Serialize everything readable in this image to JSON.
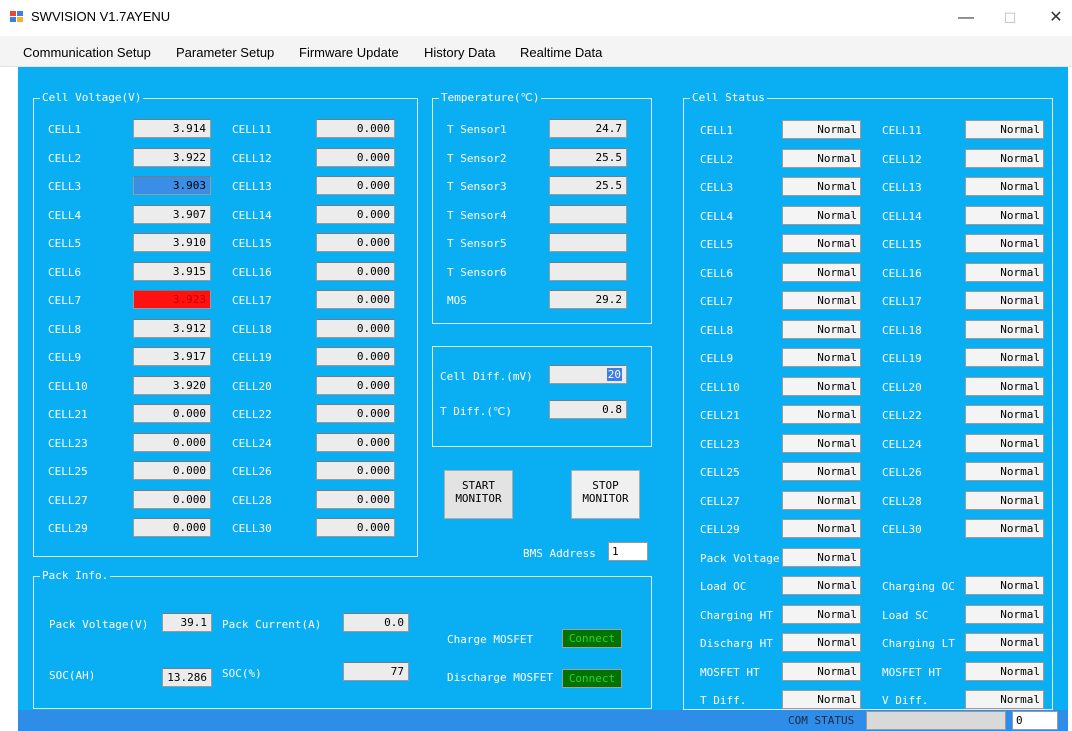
{
  "title": "SWVISION V1.7AYENU",
  "titlebar": {
    "minimize": "—",
    "maximize": "☐",
    "close": "✕"
  },
  "menu": [
    "Communication Setup",
    "Parameter Setup",
    "Firmware Update",
    "History Data",
    "Realtime Data"
  ],
  "colors": {
    "background": "#0aaef2",
    "status_bar": "#2d8de8",
    "highlight_blue": "#3a8ee6",
    "alarm_red": "#ff1111",
    "mosfet_on": "#027202"
  },
  "cell_voltage": {
    "title": "Cell Voltage(V)",
    "left": [
      [
        "CELL1",
        "3.914"
      ],
      [
        "CELL2",
        "3.922"
      ],
      [
        "CELL3",
        "3.903"
      ],
      [
        "CELL4",
        "3.907"
      ],
      [
        "CELL5",
        "3.910"
      ],
      [
        "CELL6",
        "3.915"
      ],
      [
        "CELL7",
        "3.923"
      ],
      [
        "CELL8",
        "3.912"
      ],
      [
        "CELL9",
        "3.917"
      ],
      [
        "CELL10",
        "3.920"
      ],
      [
        "CELL21",
        "0.000"
      ],
      [
        "CELL23",
        "0.000"
      ],
      [
        "CELL25",
        "0.000"
      ],
      [
        "CELL27",
        "0.000"
      ],
      [
        "CELL29",
        "0.000"
      ]
    ],
    "right": [
      [
        "CELL11",
        "0.000"
      ],
      [
        "CELL12",
        "0.000"
      ],
      [
        "CELL13",
        "0.000"
      ],
      [
        "CELL14",
        "0.000"
      ],
      [
        "CELL15",
        "0.000"
      ],
      [
        "CELL16",
        "0.000"
      ],
      [
        "CELL17",
        "0.000"
      ],
      [
        "CELL18",
        "0.000"
      ],
      [
        "CELL19",
        "0.000"
      ],
      [
        "CELL20",
        "0.000"
      ],
      [
        "CELL22",
        "0.000"
      ],
      [
        "CELL24",
        "0.000"
      ],
      [
        "CELL26",
        "0.000"
      ],
      [
        "CELL28",
        "0.000"
      ],
      [
        "CELL30",
        "0.000"
      ]
    ],
    "min_cell": "CELL3",
    "max_cell": "CELL7"
  },
  "temperature": {
    "title": "Temperature(℃)",
    "rows": [
      [
        "T Sensor1",
        "24.7"
      ],
      [
        "T Sensor2",
        "25.5"
      ],
      [
        "T Sensor3",
        "25.5"
      ],
      [
        "T Sensor4",
        ""
      ],
      [
        "T Sensor5",
        ""
      ],
      [
        "T Sensor6",
        ""
      ],
      [
        "MOS",
        "29.2"
      ]
    ]
  },
  "diff": {
    "cell_label": "Cell Diff.(mV)",
    "cell_value": "20",
    "t_label": "T Diff.(℃)",
    "t_value": "0.8"
  },
  "buttons": {
    "start_line1": "START",
    "start_line2": "MONITOR",
    "stop_line1": "STOP",
    "stop_line2": "MONITOR"
  },
  "bms": {
    "label": "BMS Address",
    "value": "1"
  },
  "pack": {
    "title": "Pack Info.",
    "voltage_label": "Pack Voltage(V)",
    "voltage": "39.1",
    "current_label": "Pack Current(A)",
    "current": "0.0",
    "soc_ah_label": "SOC(AH)",
    "soc_ah": "13.286",
    "soc_pct_label": "SOC(%)",
    "soc_pct": "77",
    "charge_label": "Charge MOSFET",
    "charge_state": "Connect",
    "discharge_label": "Discharge MOSFET",
    "discharge_state": "Connect"
  },
  "cell_status": {
    "title": "Cell Status",
    "left": [
      [
        "CELL1",
        "Normal"
      ],
      [
        "CELL2",
        "Normal"
      ],
      [
        "CELL3",
        "Normal"
      ],
      [
        "CELL4",
        "Normal"
      ],
      [
        "CELL5",
        "Normal"
      ],
      [
        "CELL6",
        "Normal"
      ],
      [
        "CELL7",
        "Normal"
      ],
      [
        "CELL8",
        "Normal"
      ],
      [
        "CELL9",
        "Normal"
      ],
      [
        "CELL10",
        "Normal"
      ],
      [
        "CELL21",
        "Normal"
      ],
      [
        "CELL23",
        "Normal"
      ],
      [
        "CELL25",
        "Normal"
      ],
      [
        "CELL27",
        "Normal"
      ],
      [
        "CELL29",
        "Normal"
      ],
      [
        "Pack Voltage",
        "Normal"
      ],
      [
        "Load OC",
        "Normal"
      ],
      [
        "Charging HT",
        "Normal"
      ],
      [
        "Discharg HT",
        "Normal"
      ],
      [
        "MOSFET HT",
        "Normal"
      ],
      [
        "T Diff.",
        "Normal"
      ]
    ],
    "right": [
      [
        "CELL11",
        "Normal"
      ],
      [
        "CELL12",
        "Normal"
      ],
      [
        "CELL13",
        "Normal"
      ],
      [
        "CELL14",
        "Normal"
      ],
      [
        "CELL15",
        "Normal"
      ],
      [
        "CELL16",
        "Normal"
      ],
      [
        "CELL17",
        "Normal"
      ],
      [
        "CELL18",
        "Normal"
      ],
      [
        "CELL19",
        "Normal"
      ],
      [
        "CELL20",
        "Normal"
      ],
      [
        "CELL22",
        "Normal"
      ],
      [
        "CELL24",
        "Normal"
      ],
      [
        "CELL26",
        "Normal"
      ],
      [
        "CELL28",
        "Normal"
      ],
      [
        "CELL30",
        "Normal"
      ],
      [
        "Charging OC",
        "Normal"
      ],
      [
        "Load SC",
        "Normal"
      ],
      [
        "Charging LT",
        "Normal"
      ],
      [
        "MOSFET HT",
        "Normal"
      ],
      [
        "V  Diff.",
        "Normal"
      ]
    ]
  },
  "status_bar": {
    "com_label": "COM STATUS",
    "com_value": "",
    "counter": "0"
  }
}
